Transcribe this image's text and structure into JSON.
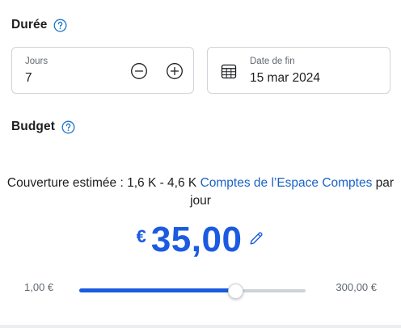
{
  "duree": {
    "title": "Durée",
    "help_icon": "question-circle-icon",
    "jours": {
      "label": "Jours",
      "value": "7",
      "minus_icon": "minus-circle-icon",
      "plus_icon": "plus-circle-icon"
    },
    "date_fin": {
      "label": "Date de fin",
      "value": "15 mar 2024",
      "icon": "calendar-icon"
    }
  },
  "budget": {
    "title": "Budget",
    "help_icon": "question-circle-icon",
    "coverage_prefix": "Couverture estimée : 1,6 K - 4,6 K ",
    "coverage_link": "Comptes de l’Espace Comptes",
    "coverage_suffix": " par jour",
    "currency": "€",
    "amount": "35,00",
    "edit_icon": "pencil-icon",
    "slider": {
      "min_label": "1,00 €",
      "max_label": "300,00 €",
      "fraction": 0.69
    }
  },
  "colors": {
    "accent": "#1a5be0",
    "link": "#1a62c4",
    "help": "#1a73c9",
    "border": "#cfd3d8"
  }
}
